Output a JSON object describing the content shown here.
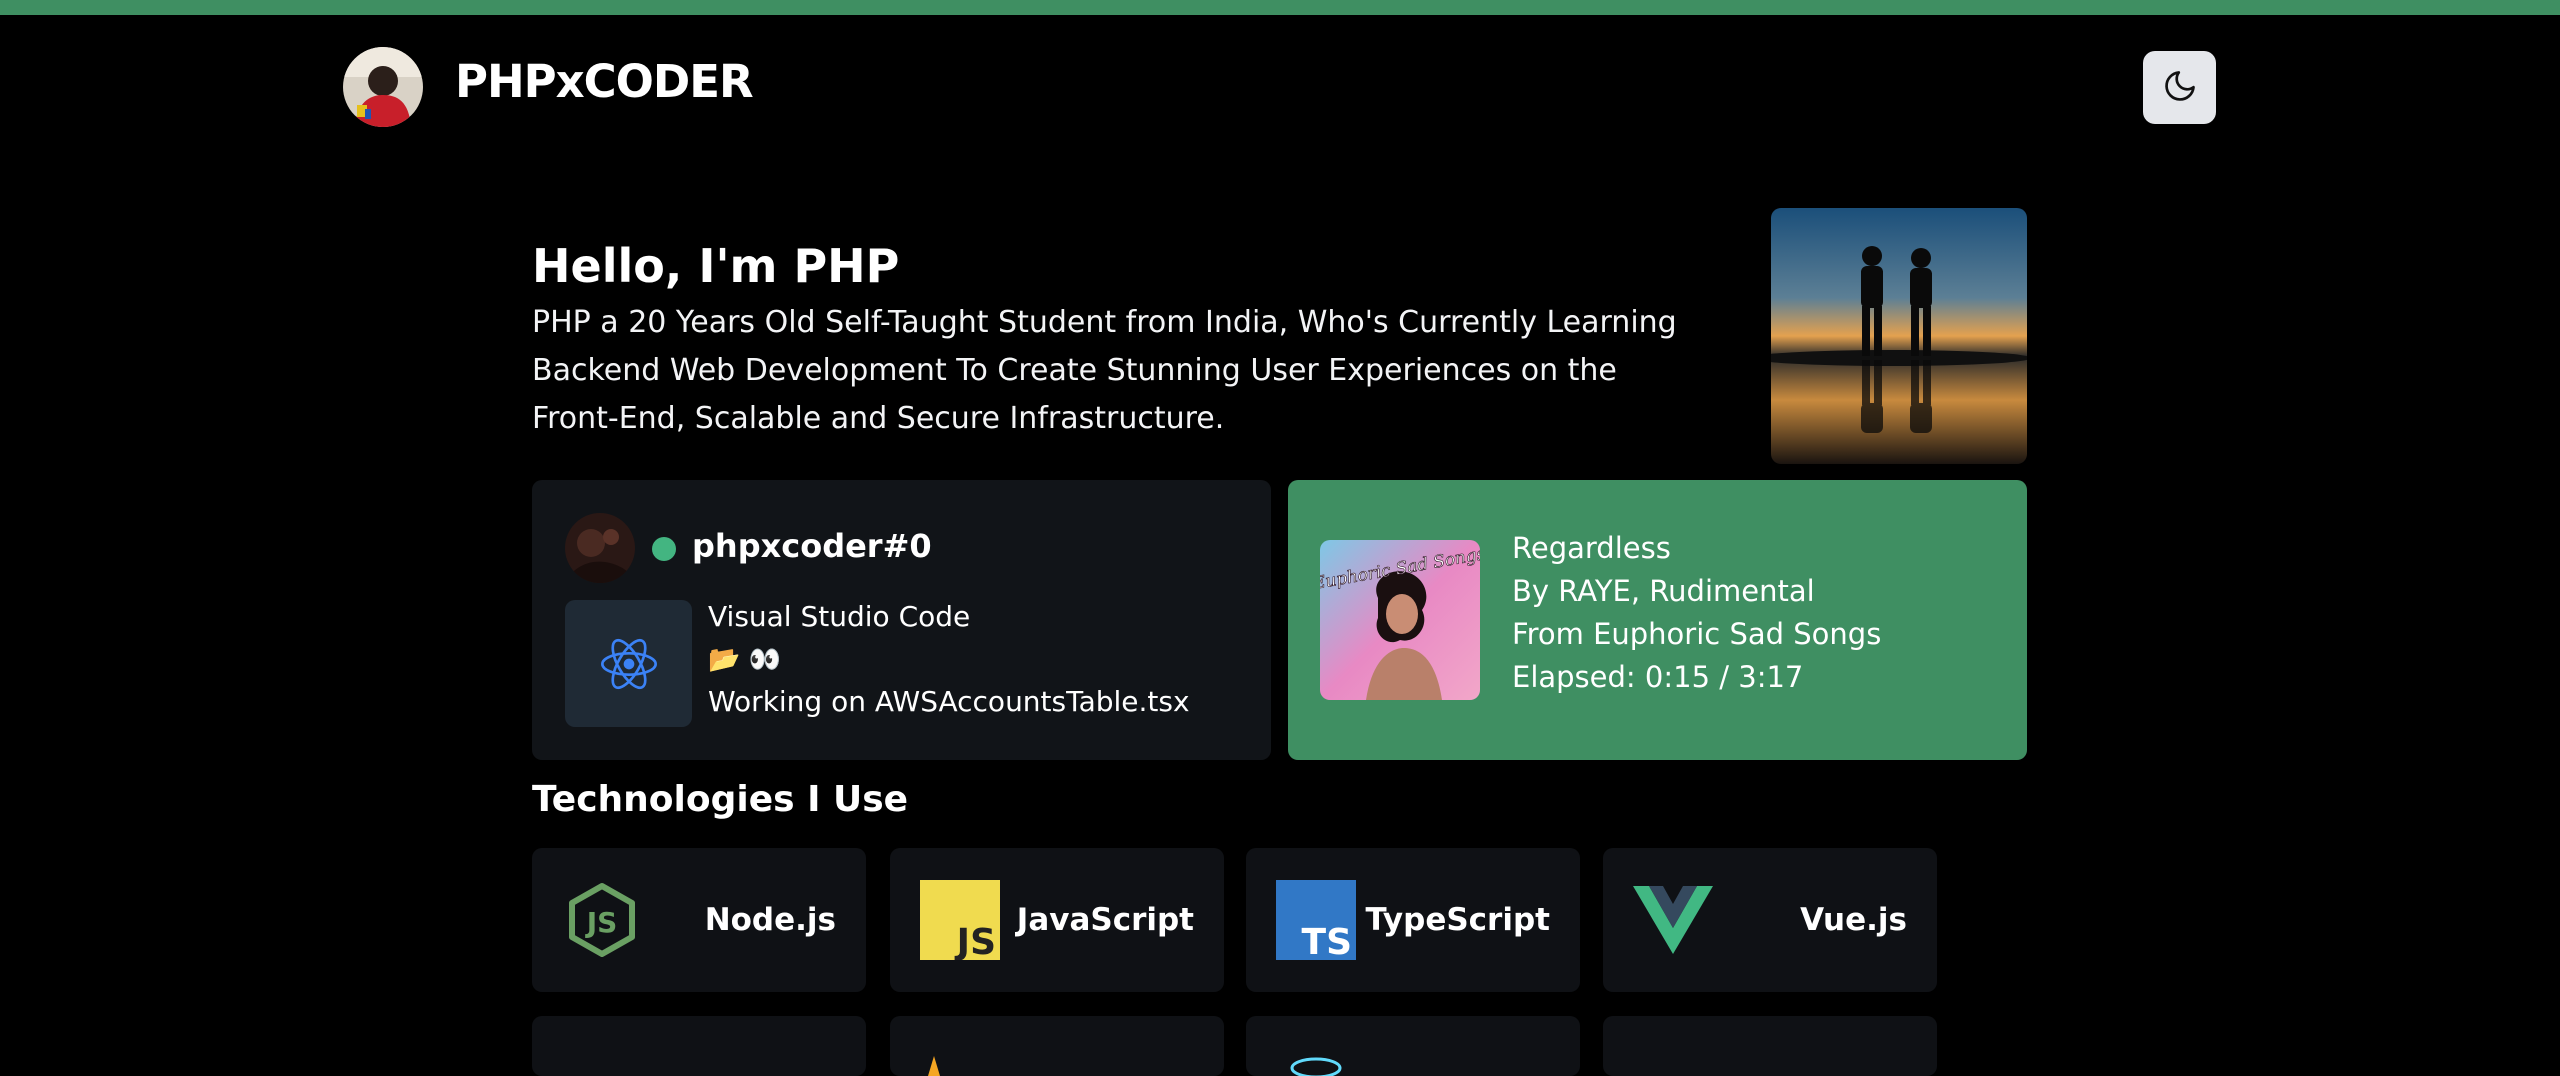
{
  "header": {
    "site_name": "PHPxCODER",
    "theme_icon": "moon-icon"
  },
  "hero": {
    "title": "Hello, I'm PHP",
    "description": "PHP a 20 Years Old Self-Taught Student from India, Who's Currently Learning Backend Web Development To Create Stunning User Experiences on the Front-End, Scalable and Secure Infrastructure."
  },
  "discord": {
    "username": "phpxcoder#0",
    "status_color": "#43b581",
    "app_name": "Visual Studio Code",
    "details": "📂 👀",
    "state": "Working on AWSAccountsTable.tsx",
    "app_icon": "react-icon"
  },
  "spotify": {
    "song": "Regardless",
    "artist": "By RAYE, Rudimental",
    "album": "From Euphoric Sad Songs",
    "elapsed": "Elapsed: 0:15 / 3:17",
    "album_art_text": "Euphoric Sad Songs",
    "card_color": "#3f8f62"
  },
  "technologies": {
    "heading": "Technologies I Use",
    "items": [
      {
        "name": "Node.js",
        "icon": "nodejs-icon"
      },
      {
        "name": "JavaScript",
        "icon": "javascript-icon"
      },
      {
        "name": "TypeScript",
        "icon": "typescript-icon"
      },
      {
        "name": "Vue.js",
        "icon": "vuejs-icon"
      }
    ]
  },
  "colors": {
    "accent": "#3f8f62",
    "background": "#000000",
    "card": "#111418"
  }
}
